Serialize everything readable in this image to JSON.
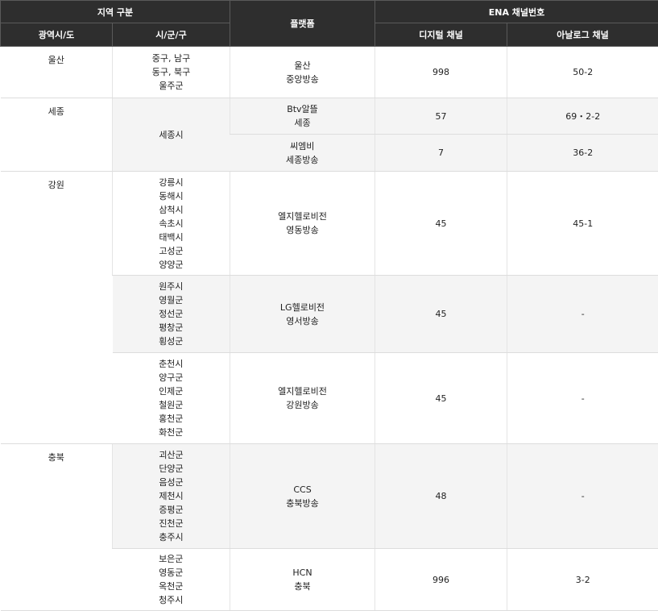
{
  "header": {
    "region_group": "지역 구분",
    "platform": "플랫폼",
    "ena_group": "ENA 채널번호",
    "province": "광역시/도",
    "city": "시/군/구",
    "digital": "디지털 채널",
    "analog": "아날로그 채널"
  },
  "rows": [
    {
      "province": "울산",
      "cities": [
        "중구, 남구",
        "동구, 북구",
        "울주군"
      ],
      "platform": [
        "울산",
        "중앙방송"
      ],
      "digital": "998",
      "analog": "50-2"
    },
    {
      "province": "세종",
      "cities": [
        "세종시"
      ],
      "platform": [
        "Btv알뜰",
        "세종"
      ],
      "digital": "57",
      "analog": "69・2-2"
    },
    {
      "platform": [
        "씨엠비",
        "세종방송"
      ],
      "digital": "7",
      "analog": "36-2"
    },
    {
      "province": "강원",
      "cities": [
        "강릉시",
        "동해시",
        "삼척시",
        "속초시",
        "태백시",
        "고성군",
        "양양군"
      ],
      "platform": [
        "엘지헬로비전",
        "영동방송"
      ],
      "digital": "45",
      "analog": "45-1"
    },
    {
      "cities": [
        "원주시",
        "영월군",
        "정선군",
        "평창군",
        "횡성군"
      ],
      "platform": [
        "LG헬로비전",
        "영서방송"
      ],
      "digital": "45",
      "analog": "-"
    },
    {
      "cities": [
        "춘천시",
        "양구군",
        "인제군",
        "철원군",
        "홍천군",
        "화천군"
      ],
      "platform": [
        "엘지헬로비전",
        "강원방송"
      ],
      "digital": "45",
      "analog": "-"
    },
    {
      "province": "충북",
      "cities": [
        "괴산군",
        "단양군",
        "음성군",
        "제천시",
        "증평군",
        "진천군",
        "충주시"
      ],
      "platform": [
        "CCS",
        "충북방송"
      ],
      "digital": "48",
      "analog": "-"
    },
    {
      "cities": [
        "보은군",
        "영동군",
        "옥천군",
        "청주시"
      ],
      "platform": [
        "HCN",
        "충북"
      ],
      "digital": "996",
      "analog": "3-2"
    }
  ]
}
